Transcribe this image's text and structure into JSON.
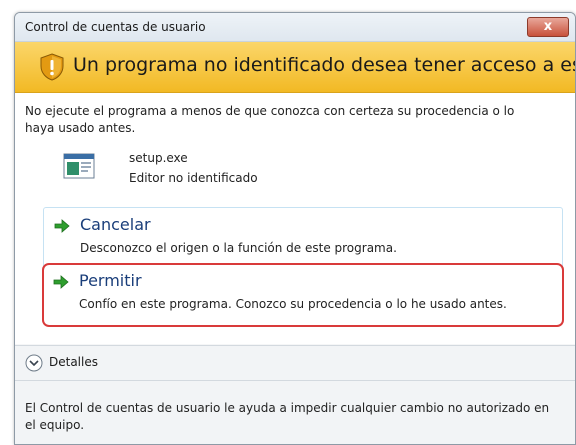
{
  "window": {
    "title": "Control de cuentas de usuario",
    "close_label": "x"
  },
  "banner": {
    "text": "Un programa no identificado desea tener acceso a este equipo",
    "icon": "shield-warning-icon"
  },
  "warning_text": "No ejecute el programa a menos de que conozca con certeza su procedencia o lo haya usado antes.",
  "program": {
    "icon": "program-icon",
    "name": "setup.exe",
    "publisher": "Editor no identificado"
  },
  "options": {
    "cancel": {
      "title": "Cancelar",
      "description": "Desconozco el origen o la función de este programa.",
      "icon": "green-arrow-icon"
    },
    "allow": {
      "title": "Permitir",
      "description": "Confío en este programa. Conozco su procedencia o lo he usado antes.",
      "icon": "green-arrow-icon"
    }
  },
  "details": {
    "label": "Detalles",
    "icon": "chevron-down-icon"
  },
  "footer_text": "El Control de cuentas de usuario le ayuda a impedir cualquier cambio no autorizado en el equipo.",
  "colors": {
    "banner": "#f2b924",
    "highlight_border": "#d93a3a",
    "option_title": "#1a3e7a",
    "arrow": "#2e9e2e"
  }
}
